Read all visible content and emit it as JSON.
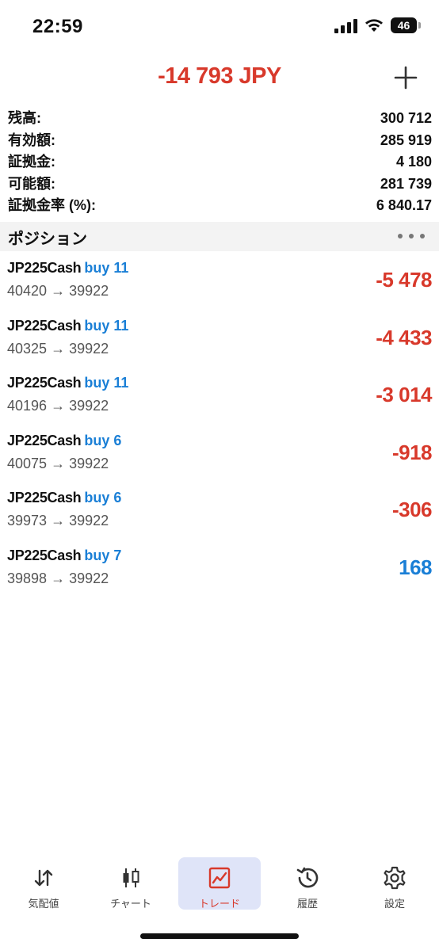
{
  "status_bar": {
    "time": "22:59",
    "battery": "46"
  },
  "header": {
    "total": "-14 793 JPY",
    "add_icon": "plus-icon"
  },
  "summary": [
    {
      "label": "残高:",
      "value": "300 712"
    },
    {
      "label": "有効額:",
      "value": "285 919"
    },
    {
      "label": "証拠金:",
      "value": "4 180"
    },
    {
      "label": "可能額:",
      "value": "281 739"
    },
    {
      "label": "証拠金率 (%):",
      "value": "6 840.17"
    }
  ],
  "positions_section": {
    "title": "ポジション",
    "more_icon": "ellipsis-icon"
  },
  "positions": [
    {
      "symbol": "JP225Cash",
      "side": "buy 11",
      "open": "40420",
      "arrow": "→",
      "current": "39922",
      "profit": "-5 478",
      "sign": "neg"
    },
    {
      "symbol": "JP225Cash",
      "side": "buy 11",
      "open": "40325",
      "arrow": "→",
      "current": "39922",
      "profit": "-4 433",
      "sign": "neg"
    },
    {
      "symbol": "JP225Cash",
      "side": "buy 11",
      "open": "40196",
      "arrow": "→",
      "current": "39922",
      "profit": "-3 014",
      "sign": "neg"
    },
    {
      "symbol": "JP225Cash",
      "side": "buy 6",
      "open": "40075",
      "arrow": "→",
      "current": "39922",
      "profit": "-918",
      "sign": "neg"
    },
    {
      "symbol": "JP225Cash",
      "side": "buy 6",
      "open": "39973",
      "arrow": "→",
      "current": "39922",
      "profit": "-306",
      "sign": "neg"
    },
    {
      "symbol": "JP225Cash",
      "side": "buy 7",
      "open": "39898",
      "arrow": "→",
      "current": "39922",
      "profit": "168",
      "sign": "pos"
    }
  ],
  "tabs": [
    {
      "label": "気配値",
      "icon": "quotes-arrows-icon"
    },
    {
      "label": "チャート",
      "icon": "candlestick-icon"
    },
    {
      "label": "トレード",
      "icon": "trade-chart-icon",
      "active": true
    },
    {
      "label": "履歴",
      "icon": "history-clock-icon"
    },
    {
      "label": "設定",
      "icon": "gear-icon"
    }
  ],
  "colors": {
    "loss": "#d8392b",
    "gain": "#1a7fd6",
    "active_tab_bg": "#dfe4f8"
  }
}
